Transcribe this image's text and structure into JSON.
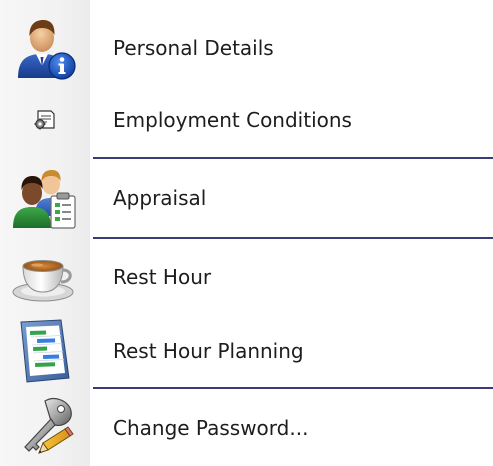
{
  "menu": {
    "items": [
      {
        "label": "Personal Details",
        "icon": "user-info-icon"
      },
      {
        "label": "Employment Conditions",
        "icon": "document-gear-icon"
      },
      {
        "label": "Appraisal",
        "icon": "people-clipboard-icon"
      },
      {
        "label": "Rest Hour",
        "icon": "coffee-cup-icon"
      },
      {
        "label": "Rest Hour Planning",
        "icon": "gantt-chart-icon"
      },
      {
        "label": "Change Password...",
        "icon": "key-pencil-icon"
      }
    ]
  }
}
